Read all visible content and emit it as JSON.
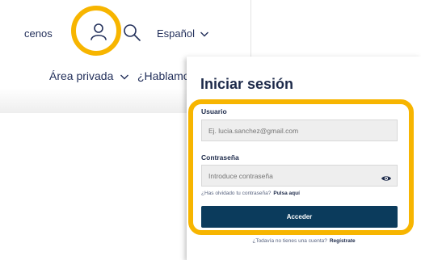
{
  "header": {
    "conocenos_label": "cenos",
    "language_label": "Español",
    "private_area_label": "Área privada",
    "hablamos_label": "¿Hablamos"
  },
  "login": {
    "title": "Iniciar sesión",
    "user_label": "Usuario",
    "user_placeholder": "Ej. lucia.sanchez@gmail.com",
    "user_value": "",
    "password_label": "Contraseña",
    "password_placeholder": "Introduce contraseña",
    "password_value": "",
    "forgot_text": "¿Has olvidado tu contraseña?",
    "forgot_link": "Pulsa aquí",
    "submit_label": "Acceder",
    "register_text": "¿Todavía no tienes una cuenta?",
    "register_link": "Regístrate"
  },
  "icons": {
    "user": "user-icon",
    "search": "search-icon",
    "language_chevron": "chevron-down-icon",
    "private_chevron": "chevron-down-icon",
    "password_toggle": "eye-icon"
  },
  "colors": {
    "highlight": "#f7b500",
    "primary_button": "#0b3b5c",
    "text_dark": "#1d2a4a",
    "input_bg": "#eeeeee"
  }
}
